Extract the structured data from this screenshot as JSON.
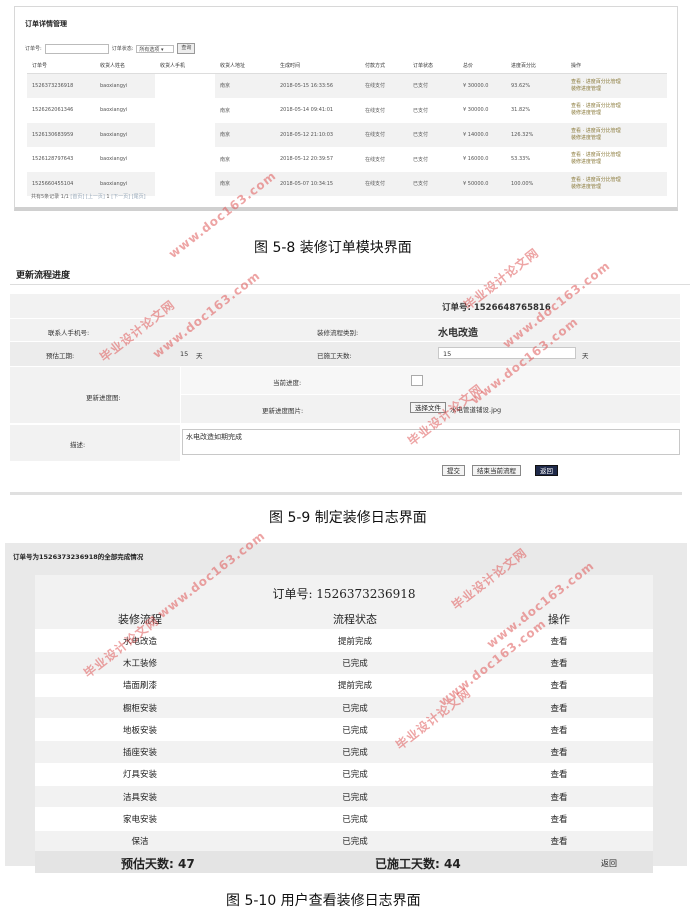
{
  "fig1": {
    "title": "订单详情管理",
    "filter": {
      "order_label": "订单号:",
      "status_label": "订单状态:",
      "status_value": "所有选项",
      "search_btn": "查询"
    },
    "columns": [
      "订单号",
      "收货人姓名",
      "收货人手机",
      "收货人地址",
      "生成时间",
      "付款方式",
      "订单状态",
      "总价",
      "进度百分比",
      "操作"
    ],
    "rows": [
      [
        "1526373236918",
        "baoxiangyi",
        "",
        "南京",
        "2018-05-15 16:33:56",
        "在线支付",
        "已支付",
        "¥ 30000.0",
        "93.62%"
      ],
      [
        "1526262061346",
        "baoxiangyi",
        "",
        "南京",
        "2018-05-14 09:41:01",
        "在线支付",
        "已支付",
        "¥ 30000.0",
        "31.82%"
      ],
      [
        "1526130683959",
        "baoxiangyi",
        "",
        "南京",
        "2018-05-12 21:10:03",
        "在线支付",
        "已支付",
        "¥ 14000.0",
        "126.32%"
      ],
      [
        "1526128797643",
        "baoxiangyi",
        "",
        "南京",
        "2018-05-12 20:39:57",
        "在线支付",
        "已支付",
        "¥ 16000.0",
        "53.33%"
      ],
      [
        "1525660455104",
        "baoxiangyi",
        "",
        "南京",
        "2018-05-07 10:34:15",
        "在线支付",
        "已支付",
        "¥ 50000.0",
        "100.00%"
      ]
    ],
    "op_line1": "查看 · 进度百分比管理",
    "op_line2": "装修进度管理",
    "pager": {
      "summary": "共有5条记录 1/1",
      "first": "[首页]",
      "prev": "[上一页]",
      "page": "1",
      "next": "[下一页]",
      "last": "[尾页]"
    }
  },
  "caption1": "图 5-8 装修订单模块界面",
  "fig2": {
    "title": "更新流程进度",
    "order": "订单号: 1526648765816",
    "contact_label": "联系人手机号:",
    "type_label": "装修流程类别:",
    "type_value": "水电改造",
    "est_label": "预估工期:",
    "est_value": "15",
    "est_unit": "天",
    "done_label": "已施工天数:",
    "done_value": "15",
    "done_unit": "天",
    "img_label": "更新进度图:",
    "current_label": "当前进度:",
    "update_label": "更新进度图片:",
    "choose_file": "选择文件",
    "file_name": "水电管道铺设.jpg",
    "desc_label": "描述:",
    "desc_value": "水电改造如期完成",
    "btn_submit": "提交",
    "btn_finish": "结束当前流程",
    "btn_back": "返回"
  },
  "caption2": "图 5-9 制定装修日志界面",
  "fig3": {
    "title": "订单号为1526373236918的全部完成情况",
    "order": "订单号: 1526373236918",
    "columns": [
      "装修流程",
      "流程状态",
      "操作"
    ],
    "rows": [
      [
        "水电改造",
        "提前完成",
        "查看"
      ],
      [
        "木工装修",
        "已完成",
        "查看"
      ],
      [
        "墙面刷漆",
        "提前完成",
        "查看"
      ],
      [
        "橱柜安装",
        "已完成",
        "查看"
      ],
      [
        "地板安装",
        "已完成",
        "查看"
      ],
      [
        "插座安装",
        "已完成",
        "查看"
      ],
      [
        "灯具安装",
        "已完成",
        "查看"
      ],
      [
        "洁具安装",
        "已完成",
        "查看"
      ],
      [
        "家电安装",
        "已完成",
        "查看"
      ],
      [
        "保洁",
        "已完成",
        "查看"
      ]
    ],
    "est": "预估天数: 47",
    "done": "已施工天数: 44",
    "back": "返回"
  },
  "caption3": "图 5-10 用户查看装修日志界面",
  "watermark": {
    "cn": "毕业设计论文网",
    "url": "www.doc163.com"
  }
}
